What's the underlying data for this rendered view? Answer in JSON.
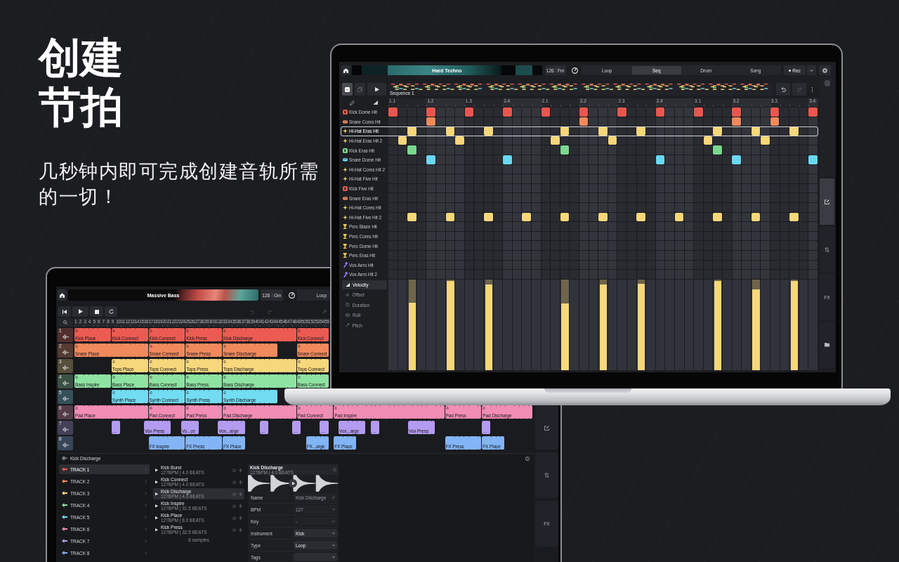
{
  "headline": {
    "title": "创建节拍",
    "subtitle": "几秒钟内即可完成创建音轨所需的一切！"
  },
  "front_screen": {
    "top_bar": {
      "title": "Hard Techno",
      "tempo": "126",
      "key": "Fm",
      "tabs": [
        {
          "label": "Loop",
          "selected": false
        },
        {
          "label": "Seq",
          "selected": true
        },
        {
          "label": "Drum",
          "selected": false
        },
        {
          "label": "Song",
          "selected": false
        }
      ],
      "record": "Rec"
    },
    "toolbar": {
      "view_toggle": {
        "on": true
      },
      "sequence_name": "Sequence 1",
      "undo": {
        "disabled": false
      },
      "redo": {
        "disabled": true
      }
    },
    "ruler": [
      "1.1",
      "1.2",
      "1.3",
      "1.4",
      "2.1",
      "2.2",
      "2.3",
      "2.4",
      "3.1",
      "3.2",
      "3.3",
      "3.4"
    ],
    "tracks": [
      {
        "name": "Kick Dome Hit",
        "kind": "kick",
        "color": "#e8574f",
        "selected": false,
        "steps": [
          true,
          false,
          false,
          false,
          true,
          false,
          false,
          false,
          true,
          false,
          false,
          false,
          true,
          false,
          false,
          false,
          true,
          false,
          false,
          false,
          true,
          false,
          false,
          false,
          true,
          false,
          false,
          false,
          true,
          false,
          false,
          false,
          true,
          false,
          false,
          false,
          true,
          false,
          false,
          false,
          true,
          false,
          false,
          false,
          true
        ]
      },
      {
        "name": "Snare Cores Hit",
        "kind": "snare",
        "color": "#ee8a5c",
        "selected": false,
        "steps": [
          false,
          false,
          false,
          false,
          true,
          false,
          false,
          false,
          false,
          false,
          false,
          false,
          false,
          false,
          false,
          false,
          false,
          false,
          false,
          false,
          true,
          false,
          false,
          false,
          false,
          false,
          false,
          false,
          false,
          false,
          false,
          false,
          false,
          false,
          false,
          false,
          true,
          false,
          false,
          false,
          true,
          false,
          false,
          false,
          false
        ]
      },
      {
        "name": "Hi-Hat Eras Hit",
        "kind": "hihat",
        "color": "#f6d77a",
        "selected": true,
        "steps": [
          false,
          false,
          true,
          false,
          false,
          false,
          true,
          false,
          false,
          false,
          true,
          false,
          false,
          false,
          false,
          false,
          false,
          false,
          true,
          false,
          false,
          false,
          true,
          false,
          false,
          false,
          true,
          false,
          false,
          false,
          false,
          false,
          false,
          false,
          true,
          false,
          false,
          false,
          true,
          false,
          false,
          false,
          true,
          false,
          false
        ]
      },
      {
        "name": "Hi-Hat Eras Hit 2",
        "kind": "hihat",
        "color": "#f6d77a",
        "selected": false,
        "steps": [
          false,
          true,
          false,
          false,
          false,
          false,
          false,
          true,
          false,
          false,
          false,
          false,
          false,
          false,
          false,
          false,
          false,
          true,
          false,
          false,
          false,
          false,
          false,
          true,
          false,
          false,
          false,
          false,
          false,
          false,
          false,
          false,
          false,
          true,
          false,
          false,
          false,
          false,
          false,
          true,
          false,
          false,
          false,
          false,
          false
        ]
      },
      {
        "name": "Kick Eras Hit",
        "kind": "kick",
        "color": "#7ad88e",
        "selected": false,
        "steps": [
          false,
          false,
          true,
          false,
          false,
          false,
          false,
          false,
          false,
          false,
          false,
          false,
          false,
          false,
          false,
          false,
          false,
          false,
          true,
          false,
          false,
          false,
          false,
          false,
          false,
          false,
          false,
          false,
          false,
          false,
          false,
          false,
          false,
          false,
          true,
          false,
          false,
          false,
          false,
          false,
          false,
          false,
          false,
          false,
          false
        ]
      },
      {
        "name": "Snare Dome Hit",
        "kind": "snare",
        "color": "#6ad8f2",
        "selected": false,
        "steps": [
          false,
          false,
          false,
          false,
          true,
          false,
          false,
          false,
          false,
          false,
          false,
          false,
          true,
          false,
          false,
          false,
          false,
          false,
          false,
          false,
          false,
          false,
          false,
          false,
          false,
          false,
          false,
          false,
          true,
          false,
          false,
          false,
          false,
          false,
          false,
          false,
          true,
          false,
          false,
          false,
          false,
          false,
          false,
          false,
          true
        ]
      },
      {
        "name": "Hi-Hat Cores Hit 2",
        "kind": "hihat",
        "color": "#f6d77a",
        "selected": false
      },
      {
        "name": "Hi-Hat Five Hit",
        "kind": "hihat",
        "color": "#f6d77a",
        "selected": false
      },
      {
        "name": "Kick Five Hit",
        "kind": "kick",
        "color": "#e8574f",
        "selected": false
      },
      {
        "name": "Snare Eras Hit",
        "kind": "snare",
        "color": "#ee8a5c",
        "selected": false
      },
      {
        "name": "Hi-Hat Cores Hit",
        "kind": "hihat",
        "color": "#f6d77a",
        "selected": false
      },
      {
        "name": "Hi-Hat Five Hit 2",
        "kind": "hihat",
        "color": "#f6d77a",
        "selected": false,
        "steps": [
          false,
          false,
          true,
          false,
          false,
          false,
          true,
          false,
          false,
          false,
          true,
          false,
          false,
          false,
          true,
          false,
          false,
          false,
          true,
          false,
          false,
          false,
          true,
          false,
          false,
          false,
          true,
          false,
          false,
          false,
          true,
          false,
          false,
          false,
          true,
          false,
          false,
          false,
          true,
          false,
          false,
          false,
          true,
          false,
          false
        ]
      },
      {
        "name": "Perc Blaze Hit",
        "kind": "perc",
        "color": "#e9c45c",
        "selected": false
      },
      {
        "name": "Perc Cores Hit",
        "kind": "perc",
        "color": "#e9c45c",
        "selected": false
      },
      {
        "name": "Perc Dome Hit",
        "kind": "perc",
        "color": "#e9c45c",
        "selected": false
      },
      {
        "name": "Perc Eras Hit",
        "kind": "perc",
        "color": "#e9c45c",
        "selected": false
      },
      {
        "name": "Vox Aero Hit",
        "kind": "vox",
        "color": "#9277ee",
        "selected": false
      },
      {
        "name": "Vox Aero Hit 2",
        "kind": "vox",
        "color": "#9277ee",
        "selected": false
      }
    ],
    "velocity": {
      "tools": [
        {
          "label": "Velocity",
          "kind": "velocity",
          "selected": true
        },
        {
          "label": "Offset",
          "kind": "offset",
          "selected": false
        },
        {
          "label": "Duration",
          "kind": "duration",
          "selected": false
        },
        {
          "label": "Roll",
          "kind": "roll",
          "selected": false
        },
        {
          "label": "Pitch",
          "kind": "pitch",
          "selected": false
        }
      ],
      "bars": [
        {
          "level": 0.76
        },
        {
          "level": 1
        },
        {
          "level": 0.96
        },
        {
          "level": 0.75
        },
        {
          "level": 0.96
        },
        {
          "level": 0.97
        },
        {
          "level": 1
        },
        {
          "level": 0.91
        },
        {
          "level": 1
        }
      ]
    },
    "side_tabs": [
      {
        "kind": "edit",
        "selected": true
      },
      {
        "kind": "mixer",
        "selected": false
      },
      {
        "kind": "fx",
        "label": "FX",
        "selected": false
      },
      {
        "kind": "folder",
        "selected": false
      }
    ]
  },
  "back_screen": {
    "top_bar": {
      "title": "Massive Bass",
      "tempo": "128",
      "key": "Gm",
      "tabs": [
        {
          "label": "Loop",
          "selected": false
        }
      ]
    },
    "transport": {
      "undo": {
        "disabled": true
      },
      "redo": {
        "disabled": true
      }
    },
    "ruler": [
      "1",
      "2",
      "3",
      "4",
      "5",
      "6",
      "7",
      "8",
      "9",
      "10",
      "11",
      "12",
      "13",
      "14",
      "15",
      "16",
      "17",
      "18",
      "19",
      "20",
      "21",
      "22",
      "23",
      "24",
      "25",
      "26",
      "27",
      "28",
      "29",
      "30",
      "31",
      "32",
      "33",
      "34",
      "35",
      "36",
      "37",
      "38",
      "39",
      "40",
      "41",
      "42",
      "43",
      "44",
      "45",
      "46",
      "47",
      "48",
      "49",
      "50",
      "51",
      "52",
      "53",
      "54",
      "55"
    ],
    "lanes": [
      {
        "number": "1",
        "kind": "loop",
        "color": "#ec5b52",
        "clips": [
          "Kick Place",
          "Kick Connect",
          "Kick Connect",
          "Kick Press",
          "Kick Discharge",
          "Kick Connect"
        ]
      },
      {
        "number": "2",
        "kind": "loop",
        "color": "#f08a5d",
        "clips": [
          "Snare Place",
          "Snare Connect",
          "Snare Press",
          "Snare Discharge",
          "Snare Connect"
        ]
      },
      {
        "number": "3",
        "kind": "loop",
        "color": "#f7d77c",
        "clips": [
          "Tops Place",
          "Tops Connect",
          "Tops Press",
          "Tops Discharge",
          "Tops Connect"
        ]
      },
      {
        "number": "4",
        "kind": "loop",
        "color": "#8ee3a2",
        "clips": [
          "Bass Inspire",
          "Bass Place",
          "Bass Connect",
          "Bass Press",
          "Bass Discharge",
          "Bass Connect"
        ]
      },
      {
        "number": "5",
        "kind": "loop",
        "color": "#72dcf2",
        "clips": [
          "Synth Place",
          "Synth Connect",
          "Synth Press",
          "Synth Discharge"
        ]
      },
      {
        "number": "6",
        "kind": "loop",
        "color": "#f28db5",
        "clips": [
          "Pad Place",
          "Pad Connect",
          "Pad Press",
          "Pad Discharge",
          "Pad Connect",
          "Pad Inspire",
          "Pad Press",
          "Pad Discharge"
        ]
      },
      {
        "number": "7",
        "kind": "oneshot",
        "color": "#b39cf0",
        "clips": [
          "…",
          "Vox Press",
          "Vo...ce",
          "Vox...arge",
          "…",
          "…",
          "…",
          "Vox...arge",
          "…",
          "Vox Press",
          "…"
        ]
      },
      {
        "number": "8",
        "kind": "oneshot",
        "color": "#82b4f6",
        "clips": [
          "FX Inspire",
          "FX Press",
          "FX Place",
          "FX...arge",
          "FX Place",
          "FX Press",
          "FX Place"
        ]
      }
    ],
    "side_tabs": [
      {
        "kind": "edit"
      },
      {
        "kind": "mixer"
      },
      {
        "kind": "fx",
        "label": "FX"
      }
    ],
    "browser": {
      "title": "Kick Discharge",
      "tracks": [
        {
          "label": "TRACK 1",
          "color": "#ec5b52",
          "selected": true
        },
        {
          "label": "TRACK 2",
          "color": "#f08a5d",
          "selected": false
        },
        {
          "label": "TRACK 3",
          "color": "#f7d77c",
          "selected": false
        },
        {
          "label": "TRACK 4",
          "color": "#8ee3a2",
          "selected": false
        },
        {
          "label": "TRACK 5",
          "color": "#72dcf2",
          "selected": false
        },
        {
          "label": "TRACK 6",
          "color": "#f28db5",
          "selected": false
        },
        {
          "label": "TRACK 7",
          "color": "#b39cf0",
          "selected": false
        },
        {
          "label": "TRACK 8",
          "color": "#82b4f6",
          "selected": false
        }
      ],
      "samples": [
        {
          "name": "Kick Burst",
          "info": "127BPM | 4.0 BEATS",
          "selected": false
        },
        {
          "name": "Kick Connect",
          "info": "127BPM | 4.0 BEATS",
          "selected": false
        },
        {
          "name": "Kick Discharge",
          "info": "127BPM | 4.0 BEATS",
          "selected": true
        },
        {
          "name": "Kick Inspire",
          "info": "127BPM | 31.5 BEATS",
          "selected": false
        },
        {
          "name": "Kick Place",
          "info": "127BPM | 8.0 BEATS",
          "selected": false
        },
        {
          "name": "Kick Press",
          "info": "127BPM | 32.5 BEATS",
          "selected": false
        }
      ],
      "sample_count": "6 samples",
      "detail": {
        "title": "Kick Discharge",
        "info": "127BPM | 4.0 BEATS",
        "fields": [
          {
            "label": "Name",
            "kind": "text",
            "value": "Kick Discharge",
            "disabled": true
          },
          {
            "label": "BPM",
            "kind": "select",
            "value": "127",
            "disabled": true
          },
          {
            "label": "Key",
            "kind": "select",
            "value": "-",
            "disabled": true
          },
          {
            "label": "Instrument",
            "kind": "select",
            "value": "Kick",
            "disabled": false
          },
          {
            "label": "Type",
            "kind": "select",
            "value": "Loop",
            "disabled": false
          },
          {
            "label": "Tags",
            "kind": "select",
            "disabled": false
          }
        ]
      }
    }
  }
}
